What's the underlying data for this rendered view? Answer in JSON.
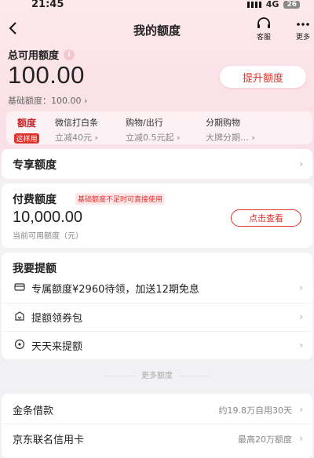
{
  "status": {
    "time": "21:45",
    "network": "4G",
    "battery": "26"
  },
  "header": {
    "title": "我的额度",
    "service_label": "客服",
    "more_label": "更多"
  },
  "total": {
    "label": "总可用额度",
    "info_icon": "i",
    "amount": "100.00",
    "base_label": "基础额度：",
    "base_value": "100.00",
    "raise_button": "提升额度"
  },
  "quota_strip": {
    "tag_top": "额度",
    "tag_bottom": "这样用",
    "items": [
      {
        "title": "微信打白条",
        "sub": "立减40元"
      },
      {
        "title": "购物/出行",
        "sub": "立减0.5元起"
      },
      {
        "title": "分期购物",
        "sub": "大牌分期…"
      }
    ]
  },
  "exclusive": {
    "label": "专享额度"
  },
  "paid": {
    "label": "付费额度",
    "hint": "基础额度不足时可直接使用",
    "amount": "10,000.00",
    "sub": "当前可用额度（元）",
    "button": "点击查看"
  },
  "raise": {
    "label": "我要提额",
    "items": [
      {
        "text": "专属额度¥2960待领，加送12期免息",
        "icon": "card-icon"
      },
      {
        "text": "提额领券包",
        "icon": "gift-icon"
      },
      {
        "text": "天天来提额",
        "icon": "target-icon"
      }
    ]
  },
  "more_divider": "更多额度",
  "more": {
    "items": [
      {
        "name": "金条借款",
        "desc": "约19.8万自用30天"
      },
      {
        "name": "京东联名信用卡",
        "desc": "最高20万额度"
      }
    ]
  }
}
